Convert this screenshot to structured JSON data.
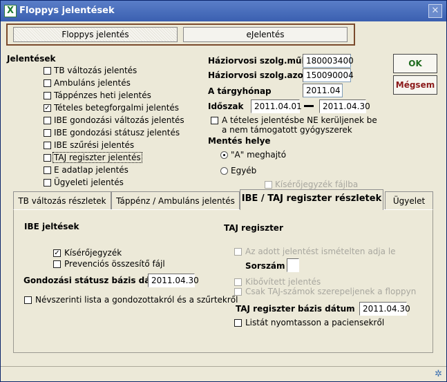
{
  "window": {
    "title": "Floppys jelentések",
    "close_glyph": "✕",
    "icon_glyph": "X"
  },
  "top_tabs": [
    "Floppys jelentés",
    "eJelentés"
  ],
  "reports": {
    "heading": "Jelentések",
    "items": [
      {
        "label": "TB változás jelentés",
        "checked": false
      },
      {
        "label": "Ambuláns jelentés",
        "checked": false
      },
      {
        "label": "Táppénzes heti jelentés",
        "checked": false
      },
      {
        "label": "Tételes betegforgalmi jelentés",
        "checked": true
      },
      {
        "label": "IBE gondozási változás jelentés",
        "checked": false
      },
      {
        "label": "IBE gondozási státusz jelentés",
        "checked": false
      },
      {
        "label": "IBE szűrési jelentés",
        "checked": false
      },
      {
        "label": "TAJ regiszter jelentés",
        "checked": false
      },
      {
        "label": "E adatlap jelentés",
        "checked": false
      },
      {
        "label": "Ügyeleti jelentés",
        "checked": false
      }
    ]
  },
  "form": {
    "szolg_muk_label": "Háziorvosi szolg.műk.",
    "szolg_muk_value": "180003400",
    "szolg_azon_label": "Háziorvosi szolg.azon.",
    "szolg_azon_value": "150090004",
    "targyhonap_label": "A tárgyhónap",
    "targyhonap_value": "2011.04",
    "idoszak_label": "Időszak",
    "idoszak_from": "2011.04.01",
    "idoszak_to": "2011.04.30",
    "ne_line1": "A tételes jelentésbe NE kerüljenek be",
    "ne_line2": "a nem támogatott gyógyszerek",
    "mentes_label": "Mentés helye",
    "drive_label": "\"A\"  meghajtó",
    "other_label": "Egyéb",
    "kiserojegyzek_fajl": "Kísérőjegyzék fájlba"
  },
  "buttons": {
    "ok": "OK",
    "cancel": "Mégsem"
  },
  "tabs": [
    "TB változás részletek",
    "Táppénz / Ambuláns jelentés",
    "IBE / TAJ regiszter részletek",
    "Ügyelet"
  ],
  "ibe": {
    "heading": "IBE jeltések",
    "kiserojegyzek": "Kísérőjegyzék",
    "prevencios": "Prevenciós összesítő fájl",
    "bazis_label": "Gondozási státusz bázis dátum",
    "bazis_value": "2011.04.30",
    "nevszerinti": "Névszerinti lista a gondozottakról és a szűrtekről"
  },
  "taj": {
    "heading": "TAJ regiszter",
    "ismetelten": "Az adott jelentést ismételten adja le",
    "sorszam": "Sorszám",
    "kibovitett": "Kibővített jelentés",
    "csak": "Csak TAJ-számok szerepeljenek a floppyn",
    "bazis_label": "TAJ regiszter bázis dátum",
    "bazis_value": "2011.04.30",
    "listat": "Listát nyomtasson a paciensekről"
  },
  "colors": {
    "ok_text": "#1e6b1e",
    "cancel_text": "#8b1a1a",
    "title_bar": "#3a5fb0"
  }
}
